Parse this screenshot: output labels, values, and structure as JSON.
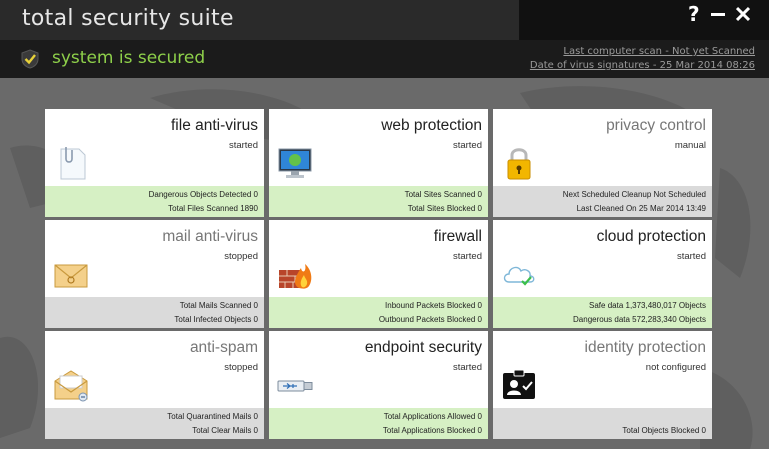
{
  "window": {
    "title": "total security suite",
    "help": "?",
    "minimize": "–",
    "close": "✕"
  },
  "status": {
    "text": "system is secured",
    "last_scan": "Last computer scan - Not yet Scanned",
    "signatures": "Date of  virus signatures - 25 Mar 2014 08:26"
  },
  "colors": {
    "secured_green": "#8ed04a",
    "stats_green": "#d6f0c4",
    "stats_gray": "#dadada"
  },
  "tiles": [
    {
      "name": "file anti-virus",
      "state": "started",
      "icon": "document-clip-icon",
      "line1": "Dangerous Objects Detected  0",
      "line2": "Total Files Scanned  1890",
      "stats": "green"
    },
    {
      "name": "web protection",
      "state": "started",
      "icon": "monitor-globe-icon",
      "line1": "Total Sites Scanned  0",
      "line2": "Total Sites Blocked  0",
      "stats": "green"
    },
    {
      "name": "privacy control",
      "state": "manual",
      "icon": "padlock-icon",
      "line1": "Next Scheduled Cleanup  Not Scheduled",
      "line2": "Last Cleaned On  25 Mar 2014 13:49",
      "stats": "gray"
    },
    {
      "name": "mail anti-virus",
      "state": "stopped",
      "icon": "envelope-icon",
      "line1": "Total Mails Scanned  0",
      "line2": "Total Infected Objects  0",
      "stats": "gray"
    },
    {
      "name": "firewall",
      "state": "started",
      "icon": "firewall-icon",
      "line1": "Inbound Packets Blocked  0",
      "line2": "Outbound Packets Blocked  0",
      "stats": "green"
    },
    {
      "name": "cloud protection",
      "state": "started",
      "icon": "cloud-check-icon",
      "line1": "Safe data 1,373,480,017 Objects",
      "line2": "Dangerous data 572,283,340 Objects",
      "stats": "green"
    },
    {
      "name": "anti-spam",
      "state": "stopped",
      "icon": "open-envelope-icon",
      "line1": "Total Quarantined Mails  0",
      "line2": "Total Clear Mails  0",
      "stats": "gray"
    },
    {
      "name": "endpoint security",
      "state": "started",
      "icon": "usb-drive-icon",
      "line1": "Total Applications Allowed  0",
      "line2": "Total Applications Blocked  0",
      "stats": "green"
    },
    {
      "name": "identity protection",
      "state": "not configured",
      "icon": "id-card-icon",
      "line1": "",
      "line2": "Total Objects Blocked 0",
      "stats": "gray"
    }
  ]
}
